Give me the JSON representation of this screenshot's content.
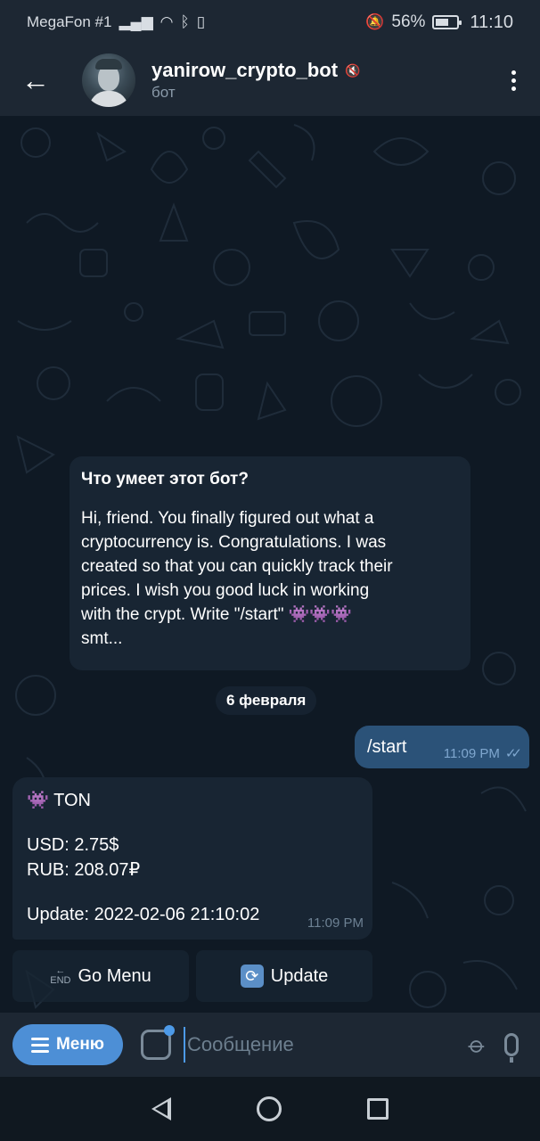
{
  "status_bar": {
    "carrier": "MegaFon #1",
    "battery_percent": "56%",
    "time": "11:10",
    "icons": [
      "signal-icon",
      "wifi-icon",
      "bluetooth-icon",
      "vibrate-icon",
      "mute-bell-icon",
      "battery-icon"
    ]
  },
  "header": {
    "title": "yanirow_crypto_bot",
    "subtitle": "бот",
    "muted": true
  },
  "info_bubble": {
    "title": "Что умеет этот бот?",
    "text": "Hi, friend. You finally figured out what a\ncryptocurrency is. Congratulations. I was\ncreated so that you can quickly track their\nprices. I wish you good luck in working\nwith the crypt. Write \"/start\" 👾👾👾\nsmt..."
  },
  "date_chip": "6 февраля",
  "outgoing_message": {
    "text": "/start",
    "time": "11:09 PM",
    "status": "read"
  },
  "incoming_message": {
    "line1": "👾 TON",
    "line2": "USD: 2.75$",
    "line3": "RUB: 208.07₽",
    "line4": "Update: 2022-02-06 21:10:02",
    "time": "11:09 PM"
  },
  "keyboard": {
    "go_menu_label": "Go Menu",
    "update_label": "Update"
  },
  "input_bar": {
    "menu_label": "Меню",
    "placeholder": "Сообщение"
  },
  "colors": {
    "bg": "#0e1621",
    "bar": "#1d2733",
    "bubble_in": "#182533",
    "bubble_out": "#2b5278",
    "accent": "#4d8fd6"
  }
}
